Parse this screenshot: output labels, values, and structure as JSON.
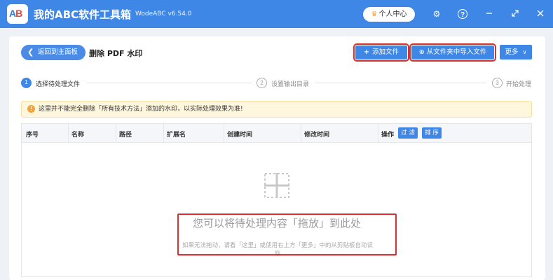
{
  "app": {
    "logo_a": "A",
    "logo_b": "B",
    "title": "我的ABC软件工具箱",
    "version": "WodeABC v6.54.0",
    "vip_label": "个人中心"
  },
  "toolbar": {
    "back_label": "返回到主面板",
    "page_title": "删除 PDF 水印",
    "add_file_label": "添加文件",
    "import_folder_label": "从文件夹中导入文件",
    "more_label": "更多"
  },
  "steps": [
    {
      "number": "1",
      "label": "选择待处理文件"
    },
    {
      "number": "2",
      "label": "设置输出目录"
    },
    {
      "number": "3",
      "label": "开始处理"
    }
  ],
  "warning": {
    "text": "这里并不能完全删除「所有技术方法」添加的水印，以实际处理效果为准!"
  },
  "table": {
    "columns": [
      "序号",
      "名称",
      "路径",
      "扩展名",
      "创建时间",
      "修改时间",
      "操作"
    ],
    "filter_label": "过 滤",
    "sort_label": "排 序"
  },
  "dropzone": {
    "main_text": "您可以将待处理内容「拖放」到此处",
    "sub_text": "如果无法拖动，请看「这里」或使用右上方「更多」中的从剪贴板自动读取"
  },
  "colors": {
    "accent": "#3f87e6",
    "highlight": "#d9312b",
    "warning_bg": "#fff7dd"
  }
}
